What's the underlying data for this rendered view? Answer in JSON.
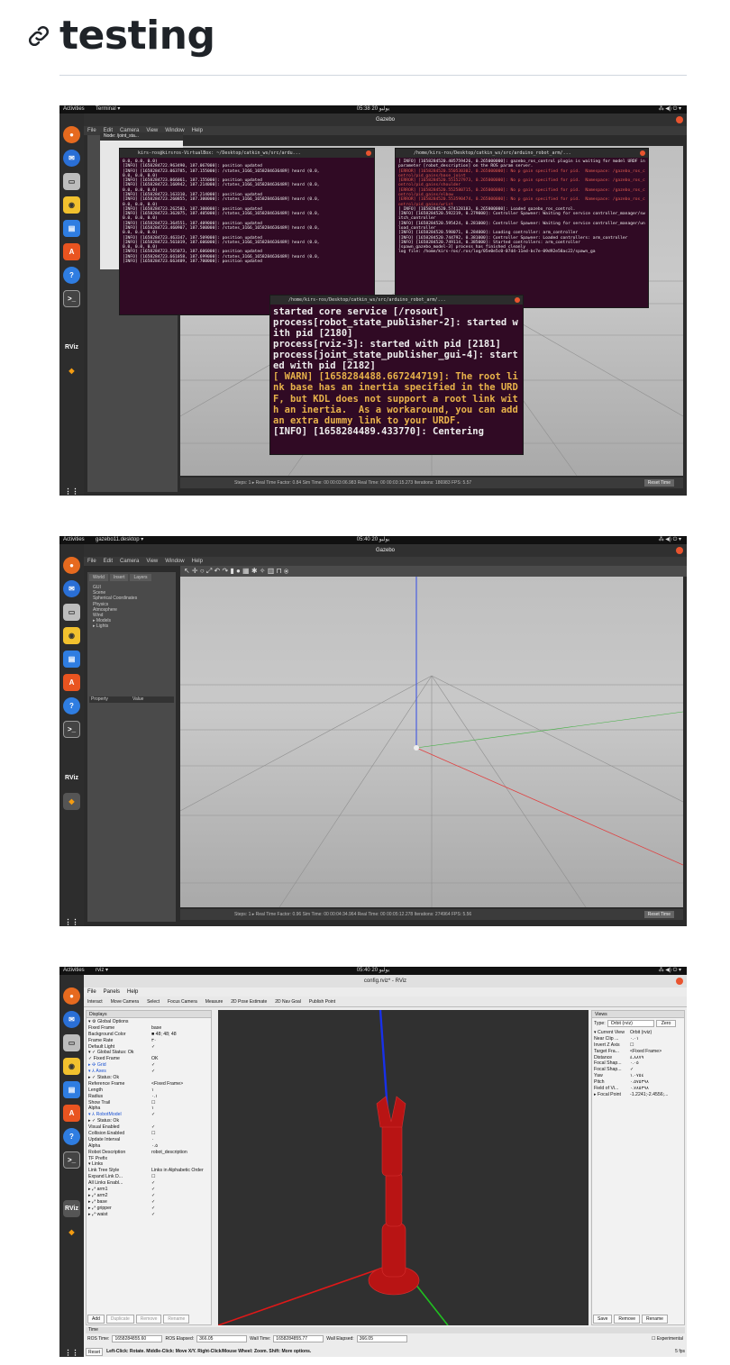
{
  "heading": {
    "title": "testing"
  },
  "shots": [
    {
      "topbar": {
        "activities": "Activities",
        "app": "Terminal ▾",
        "clock": "05:38 20 يوليو",
        "tray": "⁂ ◀) ⏻ ▾"
      },
      "window_title": "Gazebo",
      "menu": [
        "File",
        "Edit",
        "Camera",
        "View",
        "Window",
        "Help"
      ],
      "joint_panel_title": "Node: /joint_sta...",
      "terminal1": {
        "title": "kirs-ros@kirsros-VirtualBox: ~/Desktop/catkin_ws/src/ardu...",
        "lines": [
          "0.0, 0.0, 0.0)",
          "[INFO] [1658284722.963490, 187.067000]: position updated",
          "[INFO] [1658284723.063785, 187.155000]: /states_3166_1658284636489] heard (0.0,",
          "0.0, 0.0, 0.0)",
          "[INFO] [1658284723.066061, 187.155000]: position updated",
          "[INFO] [1658284723.160942, 187.214000]: /states_3166_1658284636489] heard (0.0,",
          "0.0, 0.0, 0.0)",
          "[INFO] [1658284723.163310, 187.214000]: position updated",
          "[INFO] [1658284723.260855, 187.300000]: /states_3166_1658284636489] heard (0.0,",
          "0.0, 0.0, 0.0)",
          "[INFO] [1658284723.262503, 187.300000]: position updated",
          "[INFO] [1658284723.362075, 187.405000]: /states_3166_1658284636489] heard (0.0,",
          "0.0, 0.0, 0.0)",
          "[INFO] [1658284723.364551, 187.409000]: position updated",
          "[INFO] [1658284723.460907, 187.500000]: /states_3166_1658284636489] heard (0.0,",
          "0.0, 0.0, 0.0)",
          "[INFO] [1658284723.463347, 187.509000]: position updated",
          "[INFO] [1658284723.561019, 187.606000]: /states_3166_1658284636489] heard (0.0,",
          "0.0, 0.0, 0.0)",
          "[INFO] [1658284723.565073, 187.606000]: position updated",
          "[INFO] [1658284723.661058, 187.699000]: /states_3166_1658284636489] heard (0.0,",
          "[INFO] [1658284723.663409, 187.700000]: position updated"
        ]
      },
      "terminal2": {
        "title": "/home/kirs-ros/Desktop/catkin_ws/src/arduino_robot_arm/...",
        "lines": [
          {
            "t": "[ INFO] [1658284520.405759426, 0.265000000]: gazebo_ros_control plugin is waiting for model URDF in parameter [robot_description] on the ROS param server.",
            "c": ""
          },
          {
            "t": "[ERROR] [1658284520.550530302, 0.265000000]: No p gain specified for pid.  Namespace: /gazebo_ros_control/pid_gains/base_joint",
            "c": "err"
          },
          {
            "t": "[ERROR] [1658284520.551527973, 0.265000000]: No p gain specified for pid.  Namespace: /gazebo_ros_control/pid_gains/shoulder",
            "c": "err"
          },
          {
            "t": "[ERROR] [1658284520.552580715, 0.265000000]: No p gain specified for pid.  Namespace: /gazebo_ros_control/pid_gains/elbow",
            "c": "err"
          },
          {
            "t": "[ERROR] [1658284520.553590474, 0.265000000]: No p gain specified for pid.  Namespace: /gazebo_ros_control/pid_gains/wrist",
            "c": "err"
          },
          {
            "t": "[ INFO] [1658284520.574128183, 0.265000000]: Loaded gazebo_ros_control.",
            "c": ""
          },
          {
            "t": "[INFO] [1658284520.592219, 0.279000]: Controller Spawner: Waiting for service controller_manager/switch_controller",
            "c": ""
          },
          {
            "t": "[INFO] [1658284520.595424, 0.281000]: Controller Spawner: Waiting for service controller_manager/unload_controller",
            "c": ""
          },
          {
            "t": "[INFO] [1658284520.598071, 0.284000]: Loading controller: arm_controller",
            "c": ""
          },
          {
            "t": "[INFO] [1658284520.744792, 0.381000]: Controller Spawner: Loaded controllers: arm_controller",
            "c": ""
          },
          {
            "t": "[INFO] [1658284520.749114, 0.385000]: Started controllers: arm_controller",
            "c": ""
          },
          {
            "t": "[spawn_gazebo_model-3] process has finished cleanly",
            "c": ""
          },
          {
            "t": "log file: /home/kirs-ros/.ros/log/05e0e5c0-07d4-11ed-bc7e-09d92e58ac22/spawn_ga",
            "c": ""
          }
        ]
      },
      "terminal3": {
        "title": "/home/kirs-ros/Desktop/catkin_ws/src/arduino_robot_arm/...",
        "lines": [
          {
            "t": "started core service [/rosout]",
            "c": ""
          },
          {
            "t": "process[robot_state_publisher-2]: started with pid [2180]",
            "c": ""
          },
          {
            "t": "process[rviz-3]: started with pid [2181]",
            "c": ""
          },
          {
            "t": "process[joint_state_publisher_gui-4]: started with pid [2182]",
            "c": ""
          },
          {
            "t": "[ WARN] [1658284488.667244719]: The root link base has an inertia specified in the URDF, but KDL does not support a root link with an inertia.  As a workaround, you can add an extra dummy link to your URDF.",
            "c": "warn"
          },
          {
            "t": "[INFO] [1658284489.433770]: Centering",
            "c": ""
          }
        ]
      },
      "status": {
        "text": "Steps: 1 ▸   Real Time Factor: 0.84     Sim Time: 00 00:03:06.983   Real Time: 00 00:03:15.273   Iterations: 186983   FPS: 5.57",
        "reset": "Reset Time"
      }
    },
    {
      "topbar": {
        "activities": "Activities",
        "app": "gazebo11.desktop ▾",
        "clock": "05:40 20 يوليو",
        "tray": "⁂ ◀) ⏻ ▾"
      },
      "window_title": "Gazebo",
      "menu": [
        "File",
        "Edit",
        "Camera",
        "View",
        "Window",
        "Help"
      ],
      "tabs": [
        "World",
        "Insert",
        "Layers"
      ],
      "tree": [
        "GUI",
        "Scene",
        "Spherical Coordinates",
        "Physics",
        "Atmosphere",
        "Wind",
        "▸ Models",
        "▸ Lights"
      ],
      "prop_headers": [
        "Property",
        "Value"
      ],
      "status": {
        "text": "Steps: 1 ▸   Real Time Factor: 0.96     Sim Time: 00 00:04:34.964   Real Time: 00 00:05:12.278   Iterations: 274964   FPS: 5.56",
        "reset": "Reset Time"
      }
    },
    {
      "topbar": {
        "activities": "Activities",
        "app": "rviz ▾",
        "clock": "05:40 20 يوليو",
        "tray": "⁂ ◀) ⏻ ▾"
      },
      "window_title": "config.rviz* - RViz",
      "menu": [
        "File",
        "Panels",
        "Help"
      ],
      "toolbar": [
        "Interact",
        "Move Camera",
        "Select",
        "Focus Camera",
        "Measure",
        "2D Pose Estimate",
        "2D Nav Goal",
        "Publish Point"
      ],
      "displays_title": "Displays",
      "displays": [
        {
          "k": "▾ ⚙ Global Options",
          "v": "",
          "c": ""
        },
        {
          "k": "    Fixed Frame",
          "v": "base",
          "c": ""
        },
        {
          "k": "    Background Color",
          "v": "■ 48; 48; 48",
          "c": ""
        },
        {
          "k": "    Frame Rate",
          "v": "٣٠",
          "c": ""
        },
        {
          "k": "    Default Light",
          "v": "✓",
          "c": ""
        },
        {
          "k": "▾ ✓ Global Status: Ok",
          "v": "",
          "c": ""
        },
        {
          "k": "      ✓ Fixed Frame",
          "v": "OK",
          "c": ""
        },
        {
          "k": "▸ ✣ Grid",
          "v": "✓",
          "c": "blue"
        },
        {
          "k": "▾ ⅄ Axes",
          "v": "✓",
          "c": "blue"
        },
        {
          "k": "   ▸ ✓ Status: Ok",
          "v": "",
          "c": ""
        },
        {
          "k": "    Reference Frame",
          "v": "<Fixed Frame>",
          "c": ""
        },
        {
          "k": "    Length",
          "v": "١",
          "c": ""
        },
        {
          "k": "    Radius",
          "v": "٠.١",
          "c": ""
        },
        {
          "k": "    Show Trail",
          "v": "☐",
          "c": ""
        },
        {
          "k": "    Alpha",
          "v": "١",
          "c": ""
        },
        {
          "k": "▾ ⅄ RobotModel",
          "v": "✓",
          "c": "blue"
        },
        {
          "k": "   ▸ ✓ Status: Ok",
          "v": "",
          "c": ""
        },
        {
          "k": "    Visual Enabled",
          "v": "✓",
          "c": ""
        },
        {
          "k": "    Collision Enabled",
          "v": "☐",
          "c": ""
        },
        {
          "k": "    Update Interval",
          "v": "٠",
          "c": ""
        },
        {
          "k": "    Alpha",
          "v": "٠.٥",
          "c": ""
        },
        {
          "k": "    Robot Description",
          "v": "robot_description",
          "c": ""
        },
        {
          "k": "    TF Prefix",
          "v": "",
          "c": ""
        },
        {
          "k": "  ▾ Links",
          "v": "",
          "c": ""
        },
        {
          "k": "      Link Tree Style",
          "v": "Links in Alphabetic Order",
          "c": ""
        },
        {
          "k": "      Expand Link D...",
          "v": "☐",
          "c": ""
        },
        {
          "k": "      All Links Enabl...",
          "v": "✓",
          "c": ""
        },
        {
          "k": "    ▸ ⤢ arm1",
          "v": "✓",
          "c": ""
        },
        {
          "k": "    ▸ ⤢ arm2",
          "v": "✓",
          "c": ""
        },
        {
          "k": "    ▸ ⤢ base",
          "v": "✓",
          "c": ""
        },
        {
          "k": "    ▸ ⤢ gripper",
          "v": "✓",
          "c": ""
        },
        {
          "k": "    ▸ ⤢ waist",
          "v": "✓",
          "c": ""
        }
      ],
      "display_buttons": [
        "Add",
        "Duplicate",
        "Remove",
        "Rename"
      ],
      "views_title": "Views",
      "views_type_label": "Type:",
      "views_type": "Orbit (rviz)",
      "views_zero": "Zero",
      "views": [
        {
          "k": "▾ Current View",
          "v": "Orbit (rviz)"
        },
        {
          "k": "    Near Clip ...",
          "v": "٠.٠١"
        },
        {
          "k": "    Invert Z Axis",
          "v": "☐"
        },
        {
          "k": "    Target Fra...",
          "v": "<Fixed Frame>"
        },
        {
          "k": "    Distance",
          "v": "٤.٨٨٧٩"
        },
        {
          "k": "    Focal Shap...",
          "v": "٠.٠٥"
        },
        {
          "k": "    Focal Shap...",
          "v": "✓"
        },
        {
          "k": "    Yaw",
          "v": "١.٠٧٥٤"
        },
        {
          "k": "    Pitch",
          "v": "٠.٥٧٥٣٩٨"
        },
        {
          "k": "    Field of Vi...",
          "v": "٠.٧٨٥٣٩٨"
        },
        {
          "k": "  ▸ Focal Point",
          "v": "-1.2241;-2.4556;..."
        }
      ],
      "views_buttons": [
        "Save",
        "Remove",
        "Rename"
      ],
      "time": {
        "title": "Time",
        "ros_time_label": "ROS Time:",
        "ros_time": "1658284855.60",
        "ros_elapsed_label": "ROS Elapsed:",
        "ros_elapsed": "366.05",
        "wall_time_label": "Wall Time:",
        "wall_time": "1658284855.77",
        "wall_elapsed_label": "Wall Elapsed:",
        "wall_elapsed": "366.05",
        "experimental": "Experimental"
      },
      "hint": {
        "reset": "Reset",
        "text": "Left-Click: Rotate. Middle-Click: Move X/Y. Right-Click/Mouse Wheel: Zoom. Shift: More options.",
        "fps": "5 fps"
      }
    }
  ]
}
